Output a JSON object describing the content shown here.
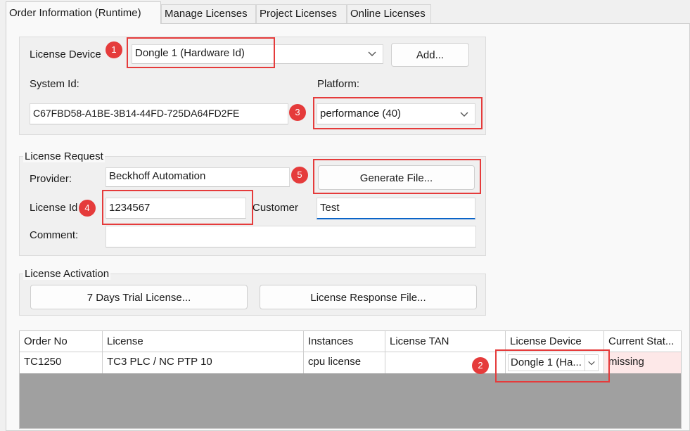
{
  "tabs": [
    {
      "label": "Order Information (Runtime)",
      "active": true
    },
    {
      "label": "Manage Licenses",
      "active": false
    },
    {
      "label": "Project Licenses",
      "active": false
    },
    {
      "label": "Online Licenses",
      "active": false
    }
  ],
  "device_group": {
    "license_device_label": "License Device",
    "license_device_value": "Dongle 1 (Hardware Id)",
    "add_button": "Add...",
    "system_id_label": "System Id:",
    "system_id_value": "C67FBD58-A1BE-3B14-44FD-725DA64FD2FE",
    "platform_label": "Platform:",
    "platform_value": "performance (40)"
  },
  "license_request": {
    "title": "License Request",
    "provider_label": "Provider:",
    "provider_value": "Beckhoff Automation",
    "generate_button": "Generate File...",
    "license_id_label": "License Id",
    "license_id_value": "1234567",
    "customer_label": "Customer",
    "customer_value": "Test",
    "comment_label": "Comment:",
    "comment_value": ""
  },
  "license_activation": {
    "title": "License Activation",
    "trial_button": "7 Days Trial License...",
    "response_button": "License Response File..."
  },
  "table": {
    "columns": [
      "Order No",
      "License",
      "Instances",
      "License TAN",
      "License Device",
      "Current Stat..."
    ],
    "rows": [
      {
        "order_no": "TC1250",
        "license": "TC3 PLC / NC PTP 10",
        "instances": "cpu license",
        "license_tan": "",
        "license_device": "Dongle 1 (Ha...",
        "current_status": "missing"
      }
    ]
  },
  "annotations": [
    "1",
    "2",
    "3",
    "4",
    "5"
  ],
  "colors": {
    "callout": "#e53b3b",
    "status_missing_bg": "#fde8e8",
    "focus_underline": "#0a64c8",
    "grid_empty_bg": "#a0a0a0"
  }
}
